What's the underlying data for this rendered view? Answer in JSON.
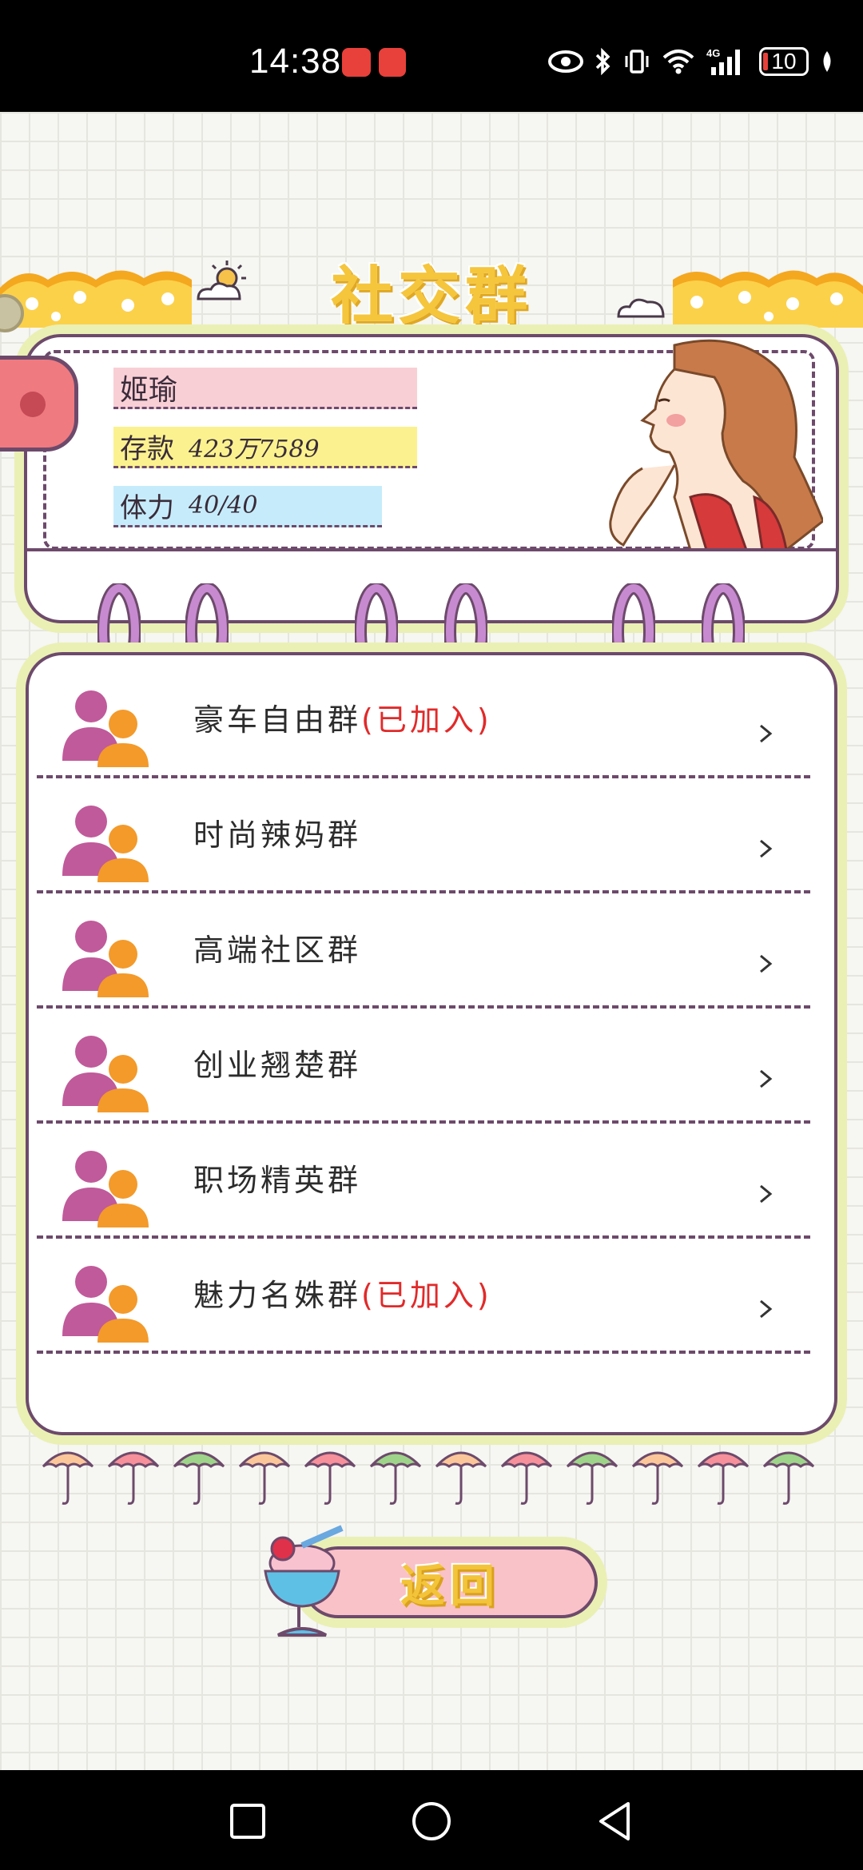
{
  "status_bar": {
    "time": "14:38",
    "network": "4G",
    "battery": "10"
  },
  "page": {
    "title": "社交群"
  },
  "profile": {
    "name": "姬瑜",
    "savings_label": "存款",
    "savings_value": "423万7589",
    "stamina_label": "体力",
    "stamina_value": "40/40"
  },
  "groups": [
    {
      "name": "豪车自由群",
      "status": "(已加入)"
    },
    {
      "name": "时尚辣妈群",
      "status": ""
    },
    {
      "name": "高端社区群",
      "status": ""
    },
    {
      "name": "创业翘楚群",
      "status": ""
    },
    {
      "name": "职场精英群",
      "status": ""
    },
    {
      "name": "魅力名姝群",
      "status": "(已加入)"
    }
  ],
  "back_button": {
    "label": "返回"
  },
  "colors": {
    "accent_yellow": "#f5c53c",
    "border_purple": "#6d4a6b",
    "joined_red": "#e12a2a",
    "name_bg": "#f9cfd6",
    "savings_bg": "#fbf28f",
    "stamina_bg": "#c6ecfb"
  },
  "icons": [
    "back-nav-icon",
    "home-nav-icon",
    "recent-apps-icon",
    "group-people-icon",
    "chevron-right-icon",
    "eye-icon",
    "bluetooth-icon",
    "wifi-icon"
  ]
}
